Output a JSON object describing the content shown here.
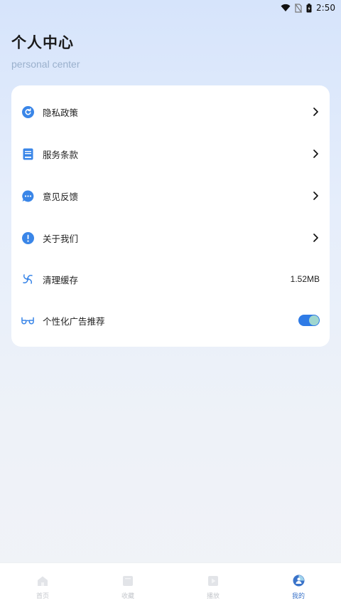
{
  "status_bar": {
    "time": "2:50"
  },
  "header": {
    "title": "个人中心",
    "subtitle": "personal center"
  },
  "settings": {
    "items": [
      {
        "label": "隐私政策",
        "icon": "refresh-circle-icon",
        "trailing": "chevron"
      },
      {
        "label": "服务条款",
        "icon": "book-icon",
        "trailing": "chevron"
      },
      {
        "label": "意见反馈",
        "icon": "chat-bubble-icon",
        "trailing": "chevron"
      },
      {
        "label": "关于我们",
        "icon": "info-exclamation-icon",
        "trailing": "chevron"
      },
      {
        "label": "清理缓存",
        "icon": "spiral-icon",
        "trailing": "value",
        "value": "1.52MB"
      },
      {
        "label": "个性化广告推荐",
        "icon": "glasses-icon",
        "trailing": "toggle",
        "toggle_on": true
      }
    ]
  },
  "tabbar": {
    "tabs": [
      {
        "label": "首页",
        "icon": "home-icon",
        "active": false
      },
      {
        "label": "收藏",
        "icon": "bookmark-icon",
        "active": false
      },
      {
        "label": "播放",
        "icon": "play-icon",
        "active": false
      },
      {
        "label": "我的",
        "icon": "profile-icon",
        "active": true
      }
    ]
  },
  "colors": {
    "accent": "#3a86e8",
    "active_tab": "#3a73c9",
    "toggle_track": "#2f7be6",
    "toggle_knob": "#9fd6cf"
  }
}
